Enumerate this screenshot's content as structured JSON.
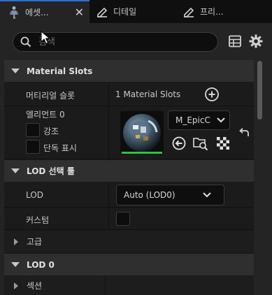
{
  "tabs": [
    {
      "label": "에셋...",
      "active": true,
      "icon": "character-icon",
      "closable": true
    },
    {
      "label": "디테일",
      "active": false,
      "icon": "pencil-icon"
    },
    {
      "label": "프리...",
      "active": false,
      "icon": "pencil-icon"
    }
  ],
  "search": {
    "placeholder": "검색"
  },
  "toolbar": {
    "table_icon": "table-icon",
    "settings_icon": "gear-icon"
  },
  "sections": {
    "material_slots": {
      "title": "Material Slots",
      "material_label": "머티리얼 슬롯",
      "material_value": "1 Material Slots",
      "element_label": "엘리먼트 0",
      "highlight_label": "강조",
      "solo_label": "단독 표시",
      "material_name": "M_EpicC"
    },
    "lod_picker": {
      "title": "LOD 선택 툴",
      "lod_label": "LOD",
      "lod_value": "Auto (LOD0)",
      "custom_label": "커스텀"
    },
    "advanced": {
      "title": "고급"
    },
    "lod0": {
      "title": "LOD 0",
      "sections_label": "섹션"
    }
  },
  "colors": {
    "accent": "#2d6fd6",
    "background": "#242424",
    "header": "#2f2f2f"
  }
}
